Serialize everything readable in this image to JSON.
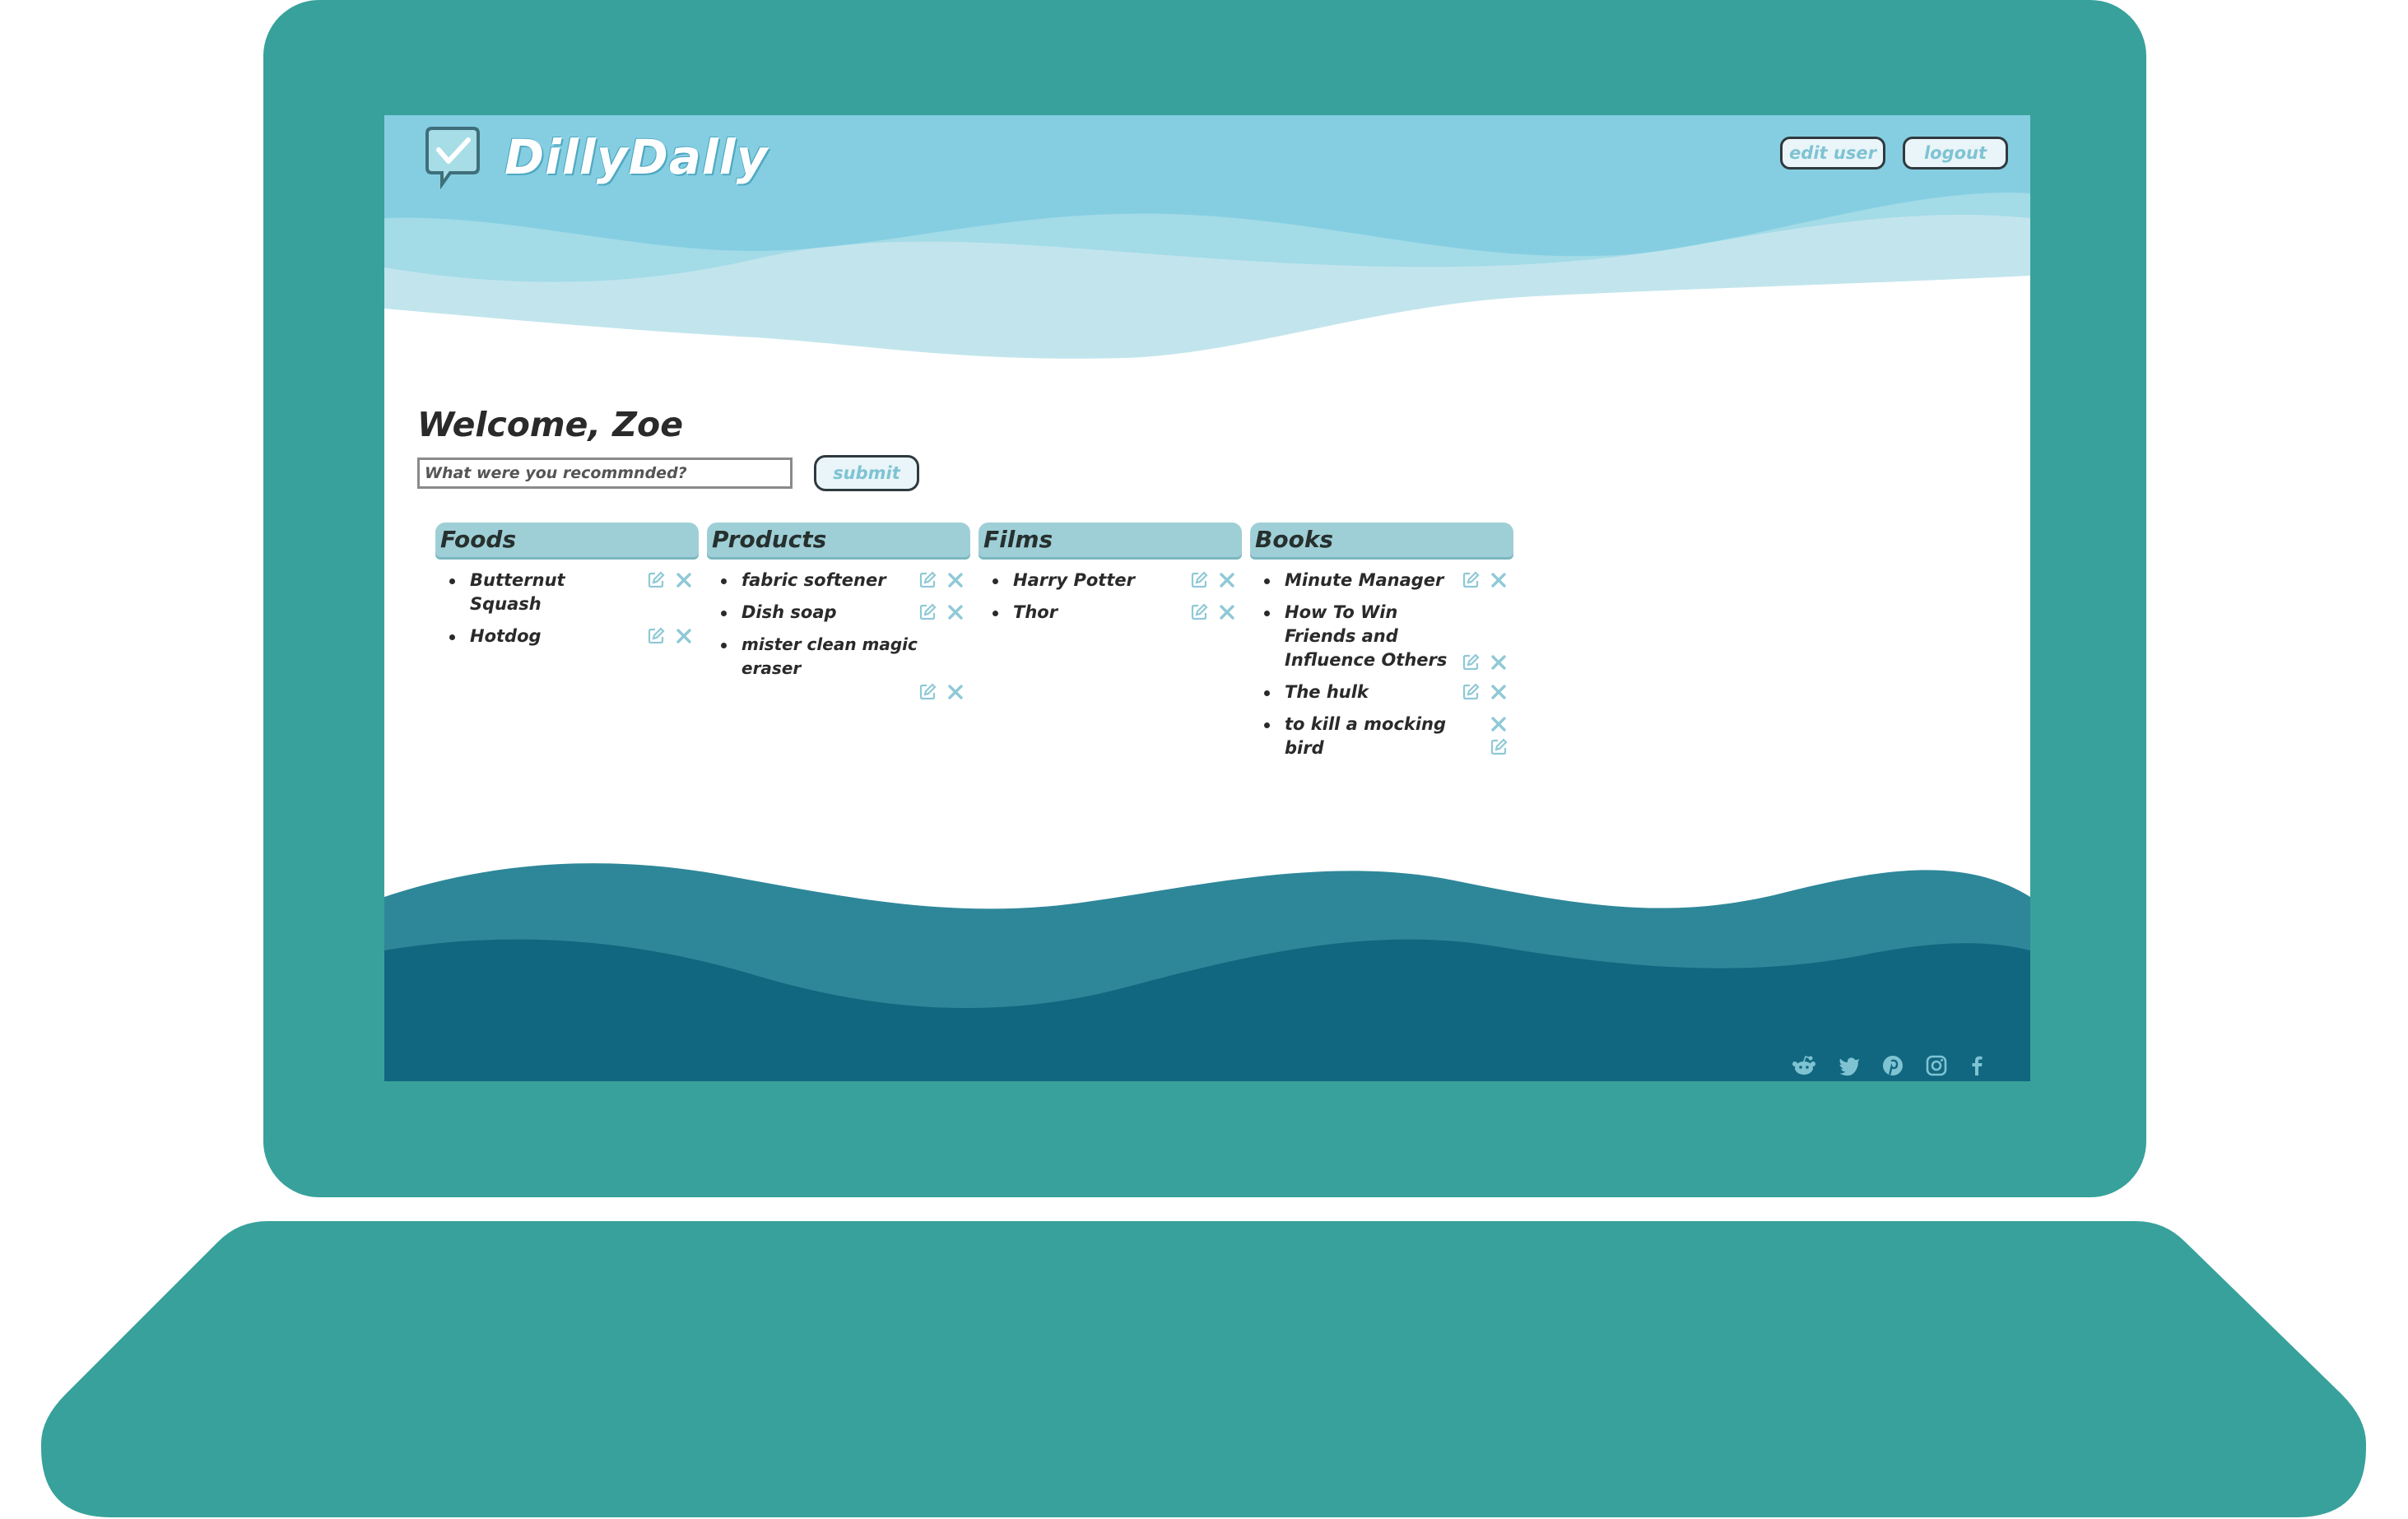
{
  "app": {
    "name": "DillyDally",
    "colors": {
      "frame": "#38a19b",
      "header_wave": "#84cfe3",
      "footer_wave": "#2e8799",
      "column_header": "#9fcfd6",
      "action_icon": "#8fc9d6"
    }
  },
  "header": {
    "edit_user_label": "edit user",
    "logout_label": "logout"
  },
  "main": {
    "welcome": "Welcome, Zoe",
    "input_placeholder": "What were you recommnded?",
    "submit_label": "submit"
  },
  "categories": [
    {
      "title": "Foods",
      "items": [
        "Butternut Squash",
        "Hotdog"
      ]
    },
    {
      "title": "Products",
      "items": [
        "fabric softener",
        "Dish soap",
        "mister clean magic eraser"
      ]
    },
    {
      "title": "Films",
      "items": [
        "Harry Potter",
        "Thor"
      ]
    },
    {
      "title": "Books",
      "items": [
        "Minute Manager",
        "How To Win Friends and Influence Others",
        "The hulk",
        "to kill a mocking bird"
      ]
    }
  ],
  "footer": {
    "social_icons": [
      "reddit-icon",
      "twitter-icon",
      "pinterest-icon",
      "instagram-icon",
      "facebook-icon"
    ]
  }
}
